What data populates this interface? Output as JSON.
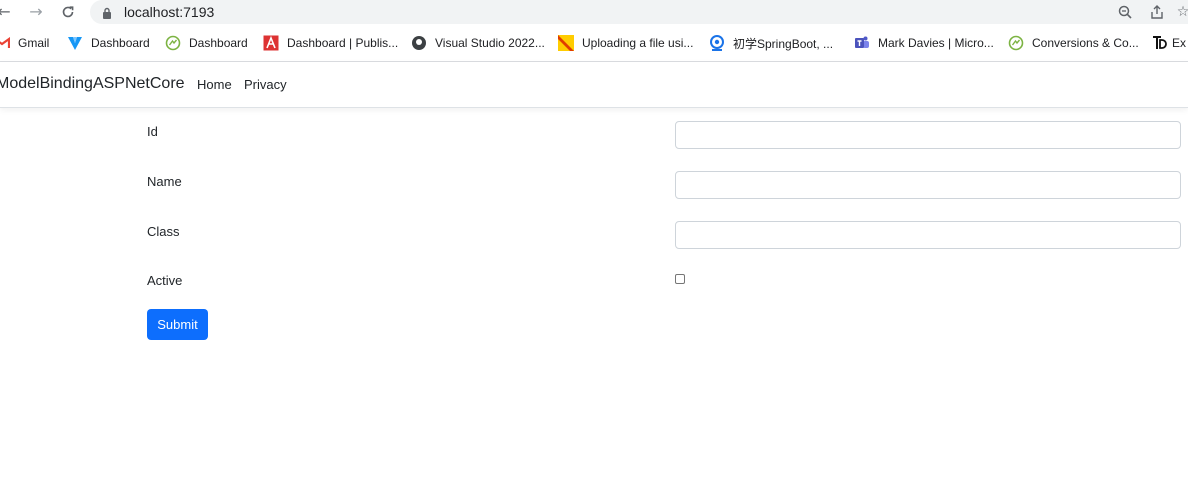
{
  "browser": {
    "url": "localhost:7193",
    "bookmarks": [
      {
        "label": "Gmail",
        "icon": "gmail-icon"
      },
      {
        "label": "Dashboard",
        "icon": "vuetify-icon"
      },
      {
        "label": "Dashboard",
        "icon": "conversions-icon"
      },
      {
        "label": "Dashboard | Publis...",
        "icon": "angular-icon"
      },
      {
        "label": "Visual Studio 2022...",
        "icon": "github-icon"
      },
      {
        "label": "Uploading a file usi...",
        "icon": "stackoverflow-icon"
      },
      {
        "label": "初学SpringBoot, ...",
        "icon": "avatar-icon"
      },
      {
        "label": "Mark Davies | Micro...",
        "icon": "teams-icon"
      },
      {
        "label": "Conversions & Co...",
        "icon": "conversions-icon"
      },
      {
        "label": "Ex",
        "icon": "td-icon"
      }
    ]
  },
  "app": {
    "brand": "ModelBindingASPNetCore",
    "nav": {
      "home": "Home",
      "privacy": "Privacy"
    }
  },
  "form": {
    "id_label": "Id",
    "name_label": "Name",
    "class_label": "Class",
    "active_label": "Active",
    "id_value": "",
    "name_value": "",
    "class_value": "",
    "active_checked": false,
    "submit_label": "Submit"
  },
  "colors": {
    "primary": "#0d6efd",
    "border": "#ced4da",
    "text": "#212529"
  }
}
